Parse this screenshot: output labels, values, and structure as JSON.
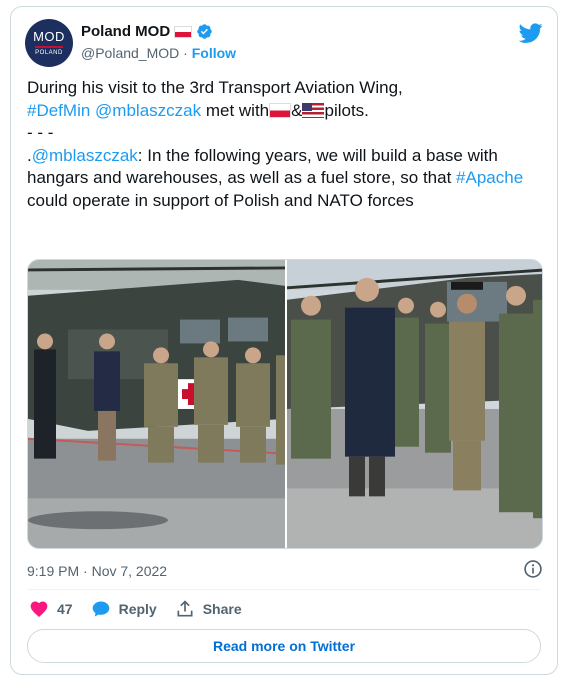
{
  "account": {
    "avatar_top": "MOD",
    "avatar_bottom": "POLAND",
    "name": "Poland MOD",
    "handle": "@Poland_MOD",
    "separator": "·",
    "follow_label": "Follow"
  },
  "tweet": {
    "line1": "During his visit to the 3rd Transport Aviation Wing,",
    "hashtag_defmin": "#DefMin",
    "mention1": "@mblaszczak",
    "met_with": " met with",
    "amp": "&",
    "pilots": "pilots.",
    "dashes": "- - -",
    "mention2_prefix": ".",
    "mention2": "@mblaszczak",
    "line3a": ": In the following years, we will build a base with hangars and warehouses, as well as a fuel store, so that ",
    "hashtag_apache": "#Apache",
    "line3b": " could operate in support of Polish and NATO forces"
  },
  "timestamp": "9:19 PM · Nov 7, 2022",
  "actions": {
    "likes_count": "47",
    "reply_label": "Reply",
    "share_label": "Share"
  },
  "read_more_label": "Read more on Twitter",
  "colors": {
    "link": "#1d9bf0",
    "like": "#f91880",
    "avatar_bg": "#1d2f5e"
  },
  "icons": [
    "verified-badge-icon",
    "twitter-bird-icon",
    "info-icon",
    "heart-icon",
    "reply-bubble-icon",
    "share-icon"
  ]
}
